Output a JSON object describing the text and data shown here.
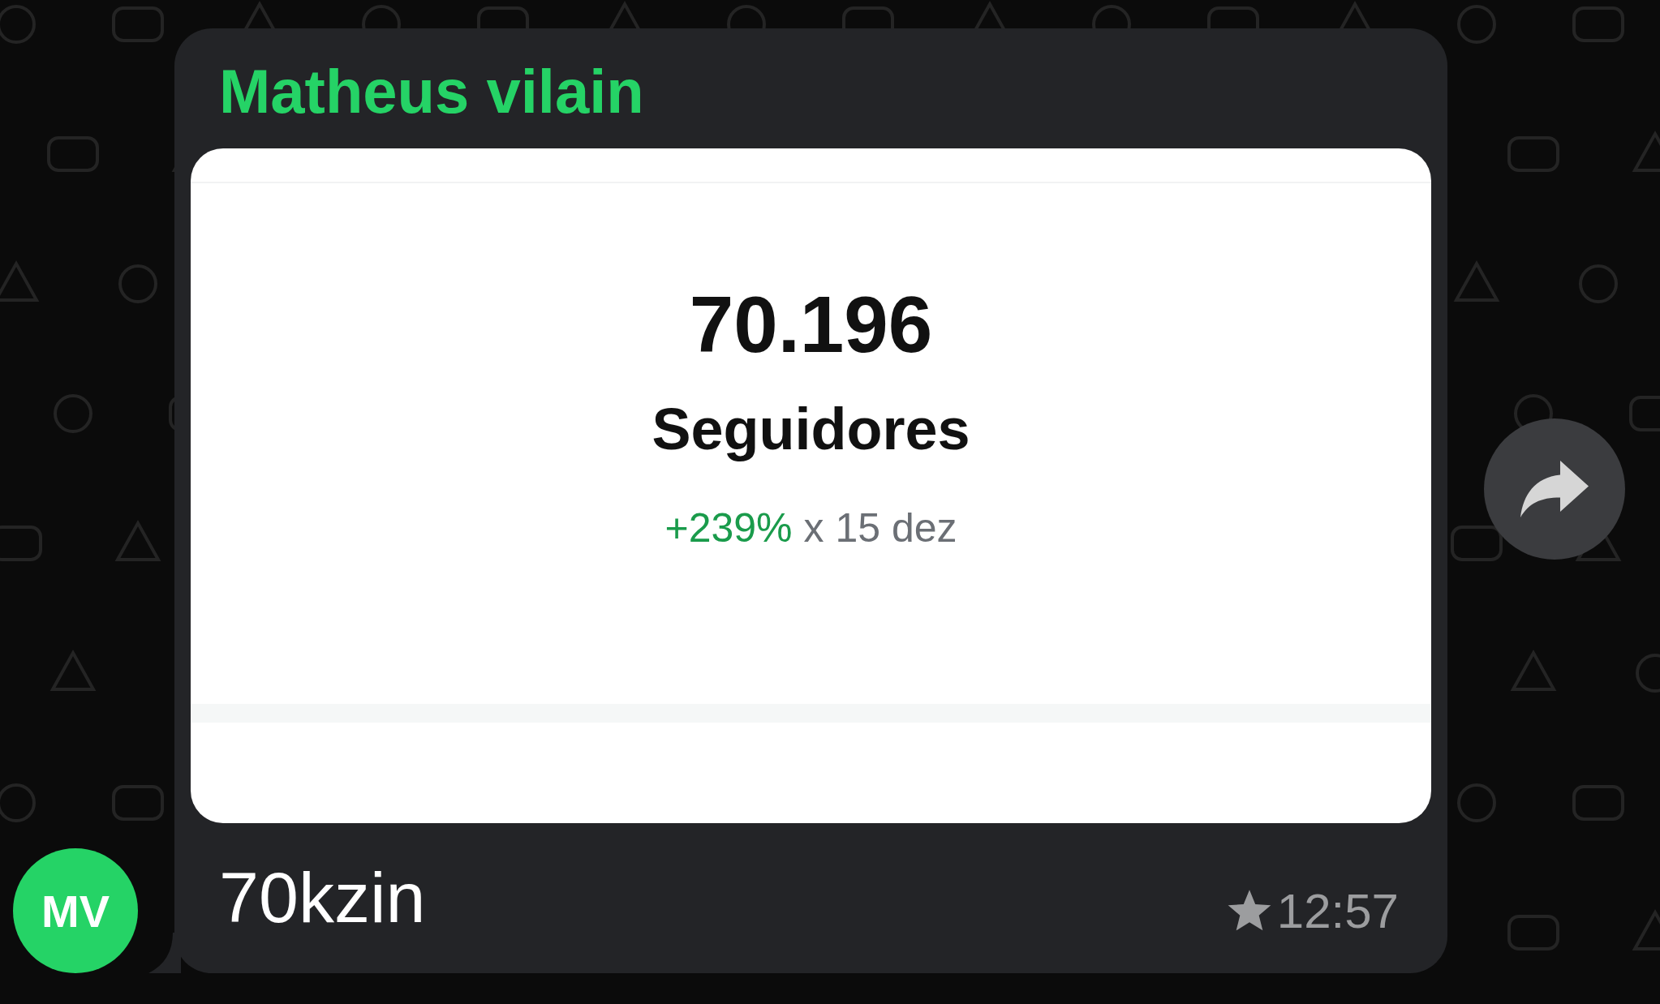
{
  "message": {
    "sender": "Matheus vilain",
    "avatar_initials": "MV",
    "card": {
      "value": "70.196",
      "label": "Seguidores",
      "change": "+239%",
      "comparison": "x 15 dez"
    },
    "caption": "70kzin",
    "starred": true,
    "time": "12:57"
  }
}
